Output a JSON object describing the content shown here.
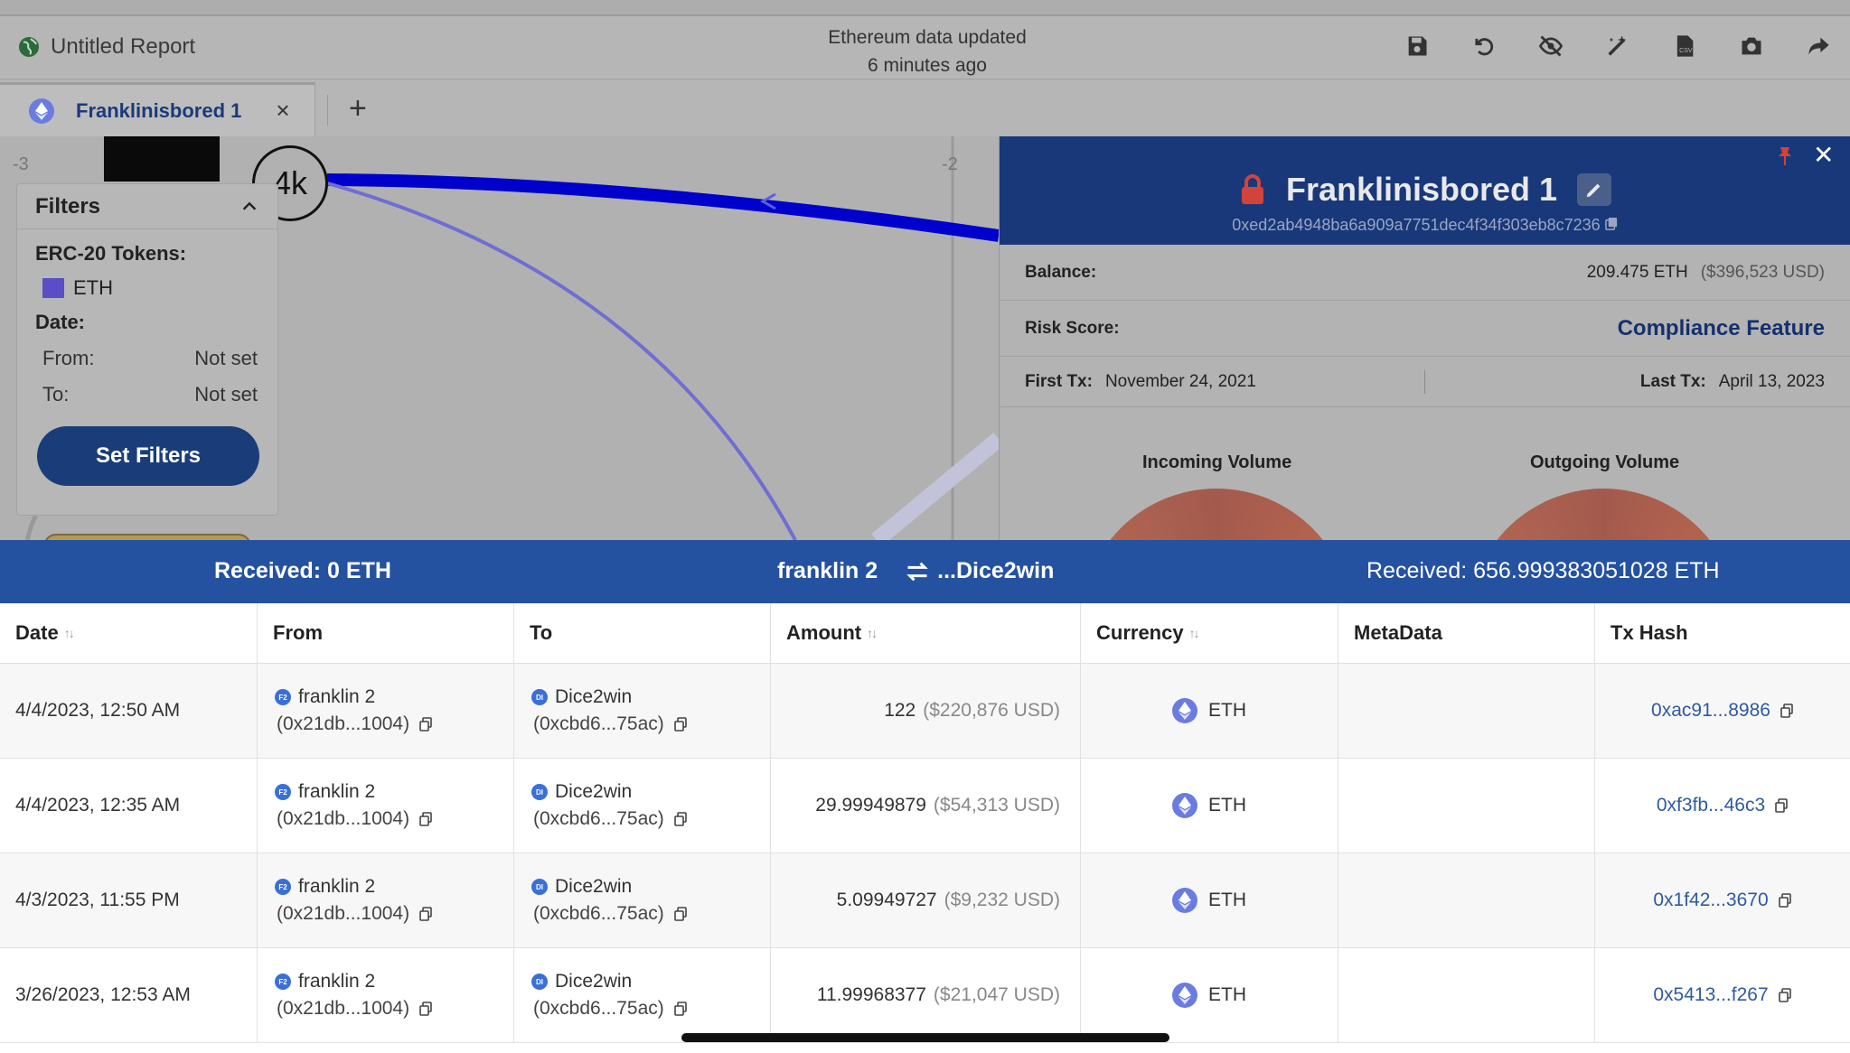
{
  "app": {
    "report_title": "Untitled Report",
    "update_line1": "Ethereum data updated",
    "update_line2": "6 minutes ago",
    "toolbar": [
      "save-icon",
      "undo-icon",
      "eye-off-icon",
      "magic-wand-icon",
      "csv-export-icon",
      "camera-icon",
      "share-icon"
    ]
  },
  "tabs": [
    {
      "label": "Franklinisbored 1",
      "close": "×"
    }
  ],
  "tab_add": "+",
  "canvas": {
    "axis_labels": [
      "-3",
      "-2"
    ],
    "node_label": "4k"
  },
  "filters": {
    "title": "Filters",
    "tokens_label": "ERC-20 Tokens:",
    "token": "ETH",
    "token_color": "#5a4ec6",
    "date_label": "Date:",
    "from_label": "From:",
    "from_value": "Not set",
    "to_label": "To:",
    "to_value": "Not set",
    "button": "Set Filters"
  },
  "wallet": {
    "name": "Franklinisbored 1",
    "address": "0xed2ab4948ba6a909a7751dec4f34f303eb8c7236",
    "balance_label": "Balance:",
    "balance_eth": "209.475 ETH",
    "balance_usd": "($396,523 USD)",
    "risk_label": "Risk Score:",
    "risk_link": "Compliance Feature",
    "first_tx_label": "First Tx:",
    "first_tx": "November 24, 2021",
    "last_tx_label": "Last Tx:",
    "last_tx": "April 13, 2023",
    "incoming_title": "Incoming Volume",
    "outgoing_title": "Outgoing Volume"
  },
  "summary": {
    "left": "Received: 0 ETH",
    "from_name": "franklin 2",
    "to_name": "...Dice2win",
    "right": "Received: 656.999383051028 ETH"
  },
  "table": {
    "headers": [
      "Date",
      "From",
      "To",
      "Amount",
      "Currency",
      "MetaData",
      "Tx Hash"
    ],
    "sort_glyph": "↑↓",
    "rows": [
      {
        "date": "4/4/2023, 12:50 AM",
        "from_name": "franklin 2",
        "from_addr": "(0x21db...1004)",
        "from_avatar": "F2",
        "to_name": "Dice2win",
        "to_addr": "(0xcbd6...75ac)",
        "to_avatar": "DI",
        "amount": "122",
        "usd": "($220,876 USD)",
        "currency": "ETH",
        "meta": "",
        "hash": "0xac91...8986"
      },
      {
        "date": "4/4/2023, 12:35 AM",
        "from_name": "franklin 2",
        "from_addr": "(0x21db...1004)",
        "from_avatar": "F2",
        "to_name": "Dice2win",
        "to_addr": "(0xcbd6...75ac)",
        "to_avatar": "DI",
        "amount": "29.99949879",
        "usd": "($54,313 USD)",
        "currency": "ETH",
        "meta": "",
        "hash": "0xf3fb...46c3"
      },
      {
        "date": "4/3/2023, 11:55 PM",
        "from_name": "franklin 2",
        "from_addr": "(0x21db...1004)",
        "from_avatar": "F2",
        "to_name": "Dice2win",
        "to_addr": "(0xcbd6...75ac)",
        "to_avatar": "DI",
        "amount": "5.09949727",
        "usd": "($9,232 USD)",
        "currency": "ETH",
        "meta": "",
        "hash": "0x1f42...3670"
      },
      {
        "date": "3/26/2023, 12:53 AM",
        "from_name": "franklin 2",
        "from_addr": "(0x21db...1004)",
        "from_avatar": "F2",
        "to_name": "Dice2win",
        "to_addr": "(0xcbd6...75ac)",
        "to_avatar": "DI",
        "amount": "11.99968377",
        "usd": "($21,047 USD)",
        "currency": "ETH",
        "meta": "",
        "hash": "0x5413...f267"
      }
    ]
  },
  "colors": {
    "primary_dark": "#19387a",
    "summary_bar": "#2552a0",
    "link": "#2e5aa0",
    "edge": "#0000cc"
  }
}
